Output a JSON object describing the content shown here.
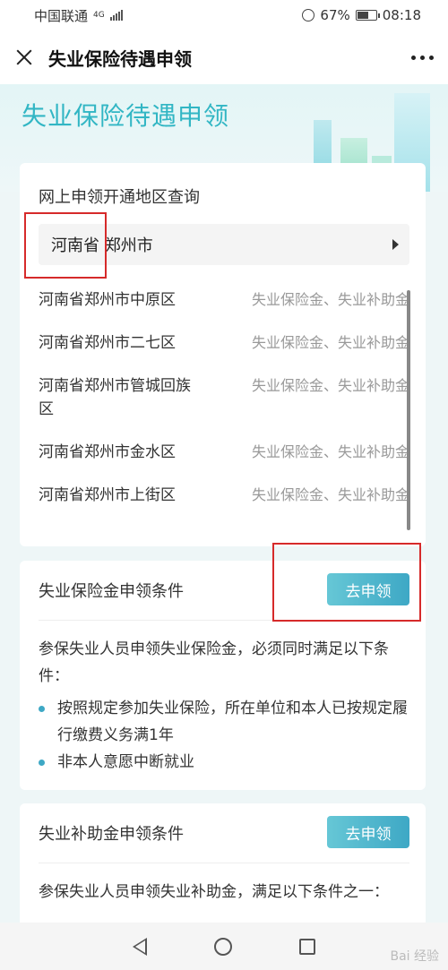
{
  "status_bar": {
    "carrier": "中国联通",
    "network": "4G",
    "battery": "67%",
    "battery_level": 0.67,
    "time": "08:18"
  },
  "nav": {
    "title": "失业保险待遇申领"
  },
  "hero": {
    "title": "失业保险待遇申领"
  },
  "region_card": {
    "title": "网上申领开通地区查询",
    "selected_region": "河南省 郑州市",
    "districts": [
      {
        "name": "河南省郑州市中原区",
        "benefit": "失业保险金、失业补助金"
      },
      {
        "name": "河南省郑州市二七区",
        "benefit": "失业保险金、失业补助金"
      },
      {
        "name": "河南省郑州市管城回族区",
        "benefit": "失业保险金、失业补助金"
      },
      {
        "name": "河南省郑州市金水区",
        "benefit": "失业保险金、失业补助金"
      },
      {
        "name": "河南省郑州市上街区",
        "benefit": "失业保险金、失业补助金"
      }
    ]
  },
  "insurance_section": {
    "title": "失业保险金申领条件",
    "apply_label": "去申领",
    "description": "参保失业人员申领失业保险金，必须同时满足以下条件：",
    "conditions": [
      "按照规定参加失业保险，所在单位和本人已按规定履行缴费义务满1年",
      "非本人意愿中断就业"
    ]
  },
  "subsidy_section": {
    "title": "失业补助金申领条件",
    "apply_label": "去申领",
    "description": "参保失业人员申领失业补助金，满足以下条件之一："
  },
  "watermark": "Bai 经验"
}
